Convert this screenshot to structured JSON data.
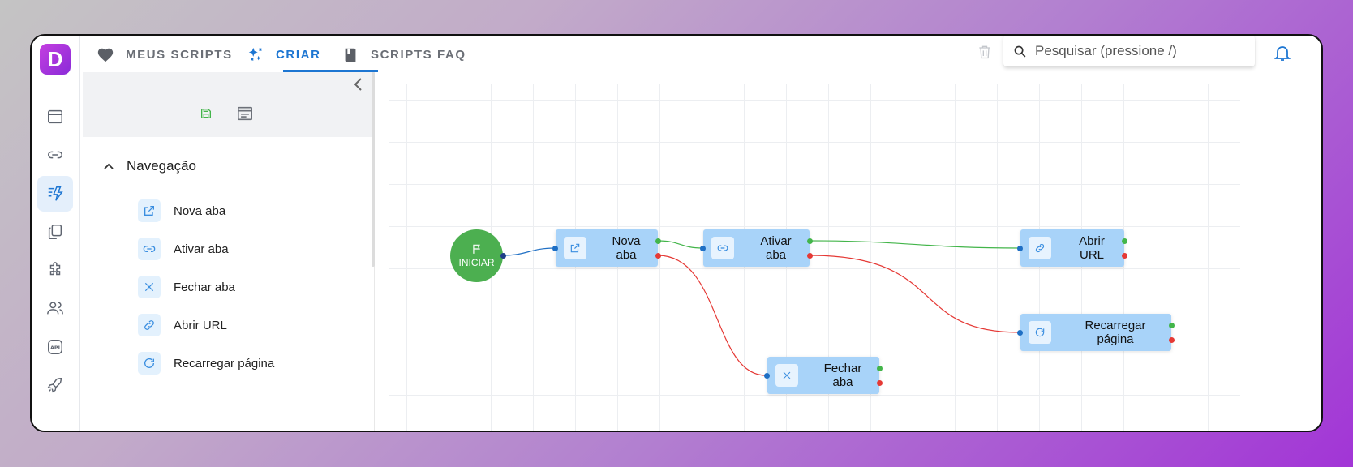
{
  "app": {
    "logo_letter": "D",
    "brand_color": "#9b34d9",
    "accent": "#1d76d2"
  },
  "rail": {
    "items": [
      {
        "icon": "window-icon"
      },
      {
        "icon": "link-icon"
      },
      {
        "icon": "flow-create-icon",
        "active": true
      },
      {
        "icon": "copy-icon"
      },
      {
        "icon": "puzzle-icon"
      },
      {
        "icon": "users-icon"
      },
      {
        "icon": "api-icon",
        "text": "API"
      },
      {
        "icon": "rocket-icon"
      }
    ]
  },
  "tabs": [
    {
      "label": "MEUS SCRIPTS",
      "icon": "heart-icon"
    },
    {
      "label": "CRIAR",
      "icon": "sparkle-icon",
      "active": true
    },
    {
      "label": "SCRIPTS FAQ",
      "icon": "book-icon"
    }
  ],
  "search": {
    "placeholder": "Pesquisar (pressione /)",
    "value": ""
  },
  "panel": {
    "section_title": "Navegação",
    "items": [
      {
        "label": "Nova aba",
        "icon": "open-external-icon"
      },
      {
        "label": "Ativar aba",
        "icon": "link-icon"
      },
      {
        "label": "Fechar aba",
        "icon": "close-icon"
      },
      {
        "label": "Abrir URL",
        "icon": "chain-link-icon"
      },
      {
        "label": "Recarregar página",
        "icon": "reload-icon"
      }
    ]
  },
  "flow": {
    "start_label": "INICIAR",
    "nodes": {
      "nova_aba": "Nova aba",
      "ativar_aba": "Ativar aba",
      "abrir_url": "Abrir URL",
      "recarregar": "Recarregar página",
      "fechar_aba": "Fechar aba"
    },
    "colors": {
      "node_bg": "#a8d3f9",
      "success": "#43b54a",
      "error": "#e53935",
      "start": "#4caf50"
    }
  }
}
